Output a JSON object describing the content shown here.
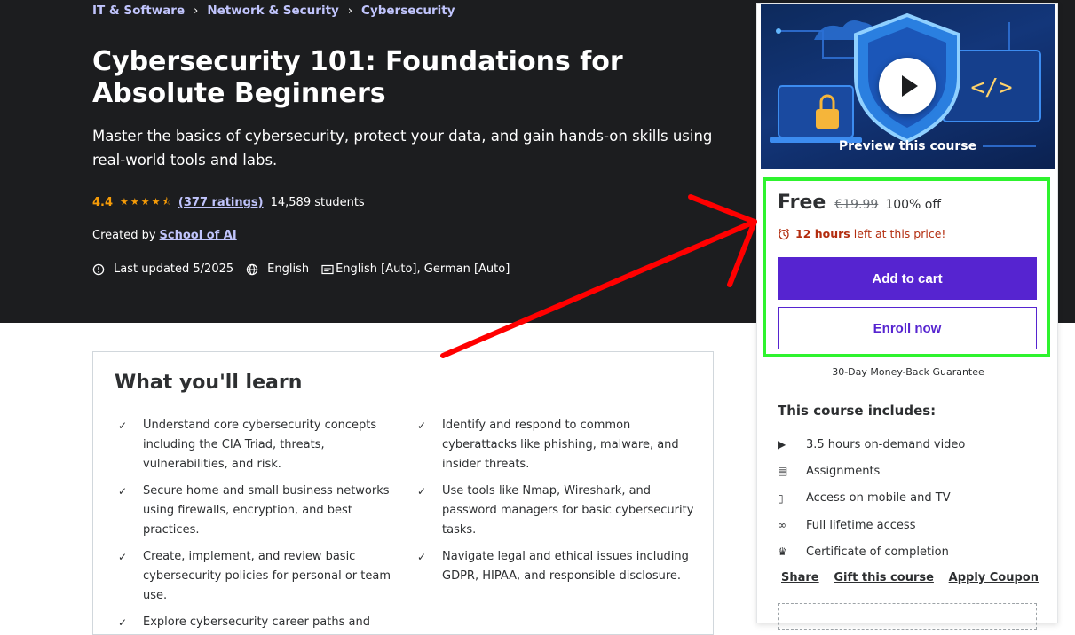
{
  "breadcrumb": {
    "items": [
      "IT & Software",
      "Network & Security",
      "Cybersecurity"
    ],
    "separator_icon": "chevron-right-icon"
  },
  "course": {
    "title": "Cybersecurity 101: Foundations for Absolute Beginners",
    "subtitle": "Master the basics of cybersecurity, protect your data, and gain hands-on skills using real-world tools and labs.",
    "rating": "4.4",
    "stars": "★★★★⯪",
    "ratings_link": "(377 ratings)",
    "students": "14,589 students",
    "created_by_label": "Created by",
    "author": "School of AI",
    "last_updated": "Last updated 5/2025",
    "language": "English",
    "captions": "English [Auto], German [Auto]"
  },
  "learn": {
    "title": "What you'll learn",
    "items": [
      "Understand core cybersecurity concepts including the CIA Triad, threats, vulnerabilities, and risk.",
      "Identify and respond to common cyberattacks like phishing, malware, and insider threats.",
      "Secure home and small business networks using firewalls, encryption, and best practices.",
      "Use tools like Nmap, Wireshark, and password managers for basic cybersecurity tasks.",
      "Create, implement, and review basic cybersecurity policies for personal or team use.",
      "Navigate legal and ethical issues including GDPR, HIPAA, and responsible disclosure.",
      "Explore cybersecurity career paths and",
      ""
    ]
  },
  "card": {
    "preview_label": "Preview this course",
    "price": "Free",
    "original_price": "€19.99",
    "discount": "100% off",
    "timer_bold": "12 hours",
    "timer_rest": "left at this price!",
    "add_to_cart": "Add to cart",
    "enroll_now": "Enroll now",
    "guarantee": "30-Day Money-Back Guarantee",
    "includes_title": "This course includes:",
    "includes": [
      {
        "icon": "video-icon",
        "glyph": "▶",
        "label": "3.5 hours on-demand video"
      },
      {
        "icon": "assignment-icon",
        "glyph": "▤",
        "label": "Assignments"
      },
      {
        "icon": "mobile-icon",
        "glyph": "▯",
        "label": "Access on mobile and TV"
      },
      {
        "icon": "infinity-icon",
        "glyph": "∞",
        "label": "Full lifetime access"
      },
      {
        "icon": "trophy-icon",
        "glyph": "♛",
        "label": "Certificate of completion"
      }
    ],
    "share": "Share",
    "gift": "Gift this course",
    "coupon": "Apply Coupon"
  },
  "colors": {
    "hero_bg": "#1c1d1f",
    "accent": "#5624d0",
    "link": "#c0c4fc",
    "star": "#f69c08",
    "timer": "#b32d0f",
    "highlight": "#2ef32e",
    "annotation_arrow": "#ff0000"
  }
}
